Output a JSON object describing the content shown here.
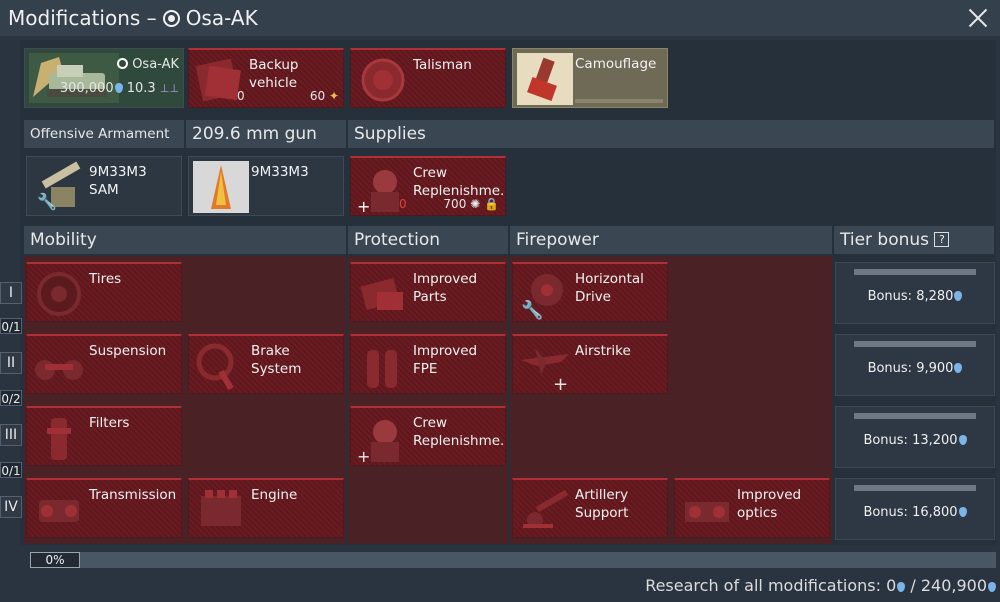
{
  "window": {
    "title_prefix": "Modifications – ",
    "vehicle_name": "Osa-AK"
  },
  "top_row": {
    "vehicle": {
      "name": "Osa-AK",
      "price": "300,000",
      "br": "10.3"
    },
    "backup": {
      "label": "Backup vehicle",
      "count": "0",
      "cost": "60"
    },
    "talisman": {
      "label": "Talisman"
    },
    "camouflage": {
      "label": "Camouflage"
    }
  },
  "sections": {
    "offensive": "Offensive Armament",
    "gun": "209.6 mm gun",
    "supplies": "Supplies",
    "mobility": "Mobility",
    "protection": "Protection",
    "firepower": "Firepower",
    "tier_bonus": "Tier bonus",
    "tier_bonus_help": "?"
  },
  "weapons": [
    {
      "label": "9M33M3 SAM"
    },
    {
      "label": "9M33M3"
    }
  ],
  "supplies_item": {
    "label": "Crew Replenishme...",
    "count": "0",
    "cost": "700"
  },
  "tiers": [
    {
      "roman": "I",
      "count": "0/1"
    },
    {
      "roman": "II",
      "count": "0/2"
    },
    {
      "roman": "III",
      "count": "0/1"
    },
    {
      "roman": "IV",
      "count": ""
    }
  ],
  "mods": {
    "tires": "Tires",
    "suspension": "Suspension",
    "brake": "Brake System",
    "filters": "Filters",
    "transmission": "Transmission",
    "engine": "Engine",
    "improved_parts": "Improved Parts",
    "improved_fpe": "Improved FPE",
    "crew_repl": "Crew Replenishme...",
    "horizontal_drive": "Horizontal Drive",
    "airstrike": "Airstrike",
    "artillery": "Artillery Support",
    "improved_optics": "Improved optics"
  },
  "bonuses": [
    {
      "text": "Bonus: 8,280"
    },
    {
      "text": "Bonus: 9,900"
    },
    {
      "text": "Bonus: 13,200"
    },
    {
      "text": "Bonus: 16,800"
    }
  ],
  "progress": {
    "label": "0%",
    "value": 0
  },
  "footer": {
    "prefix": "Research of all modifications: ",
    "current": "0",
    "sep": " / ",
    "total": "240,900"
  }
}
